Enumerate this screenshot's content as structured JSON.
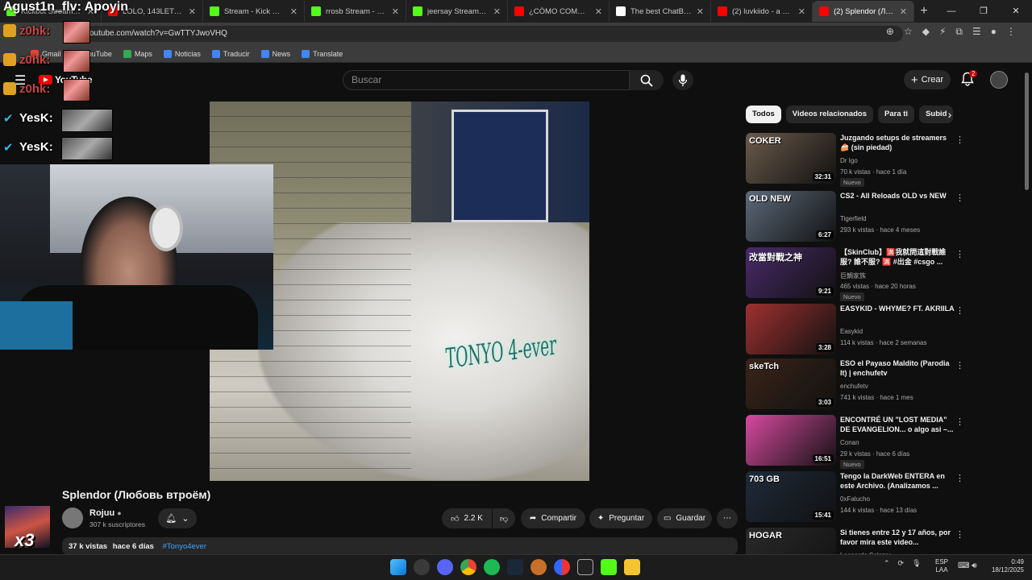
{
  "browser": {
    "tabs": [
      {
        "title": "Kickbot Stream Widget",
        "color": "#53fc18"
      },
      {
        "title": "LOLO, 143LETI - LUN",
        "color": "#ff0000"
      },
      {
        "title": "Stream - Kick Dashbo",
        "color": "#53fc18"
      },
      {
        "title": "rrosb Stream - Watch",
        "color": "#53fc18"
      },
      {
        "title": "jeersay Stream - Wat",
        "color": "#53fc18"
      },
      {
        "title": "¿CÓMO COMPRAR",
        "color": "#ff0000"
      },
      {
        "title": "The best ChatBot and",
        "color": "#ffffff"
      },
      {
        "title": "(2) luvkiido - a escon",
        "color": "#ff0000"
      },
      {
        "title": "(2) Splendor (Любовь",
        "color": "#ff0000"
      }
    ],
    "new_tab": "+",
    "url": "youtube.com/watch?v=GwTTYJwoVHQ",
    "bookmarks": [
      {
        "label": "Gmail",
        "color": "#ea4335"
      },
      {
        "label": "YouTube",
        "color": "#ff0000"
      },
      {
        "label": "Maps",
        "color": "#34a853"
      },
      {
        "label": "Noticias",
        "color": "#4285f4"
      },
      {
        "label": "Traducir",
        "color": "#4285f4"
      },
      {
        "label": "News",
        "color": "#4285f4"
      },
      {
        "label": "Translate",
        "color": "#4285f4"
      }
    ]
  },
  "youtube": {
    "logo": "YouTube",
    "search_placeholder": "Buscar",
    "create_label": "Crear",
    "notif_count": "2",
    "video_title": "Splendor (Любовь втроём)",
    "channel_name": "Rojuu",
    "channel_subs": "307 k suscriptores",
    "likes": "2.2 K",
    "share_label": "Compartir",
    "ask_label": "Preguntar",
    "save_label": "Guardar",
    "views": "37 k vistas",
    "uploaded": "hace 6 días",
    "hashtag": "#Tonyo4ever",
    "video_overlay_text": "TONYO 4-ever",
    "chips": [
      "Todos",
      "Videos relacionados",
      "Para ti",
      "Subid"
    ],
    "recommendations": [
      {
        "title": "Juzgando setups de streamers 🍰 (sin piedad)",
        "channel": "Dr Igo",
        "meta": "70 k vistas · hace 1 día",
        "duration": "32:31",
        "badge": "Nuevo",
        "thumb": "#6b5a4a",
        "thumb_text": "COKER"
      },
      {
        "title": "CS2 - All Reloads OLD vs NEW",
        "channel": "Tigerfield",
        "meta": "293 k vistas · hace 4 meses",
        "duration": "6:27",
        "badge": "",
        "thumb": "#5c6a7a",
        "thumb_text": "OLD   NEW"
      },
      {
        "title": "【SkinClub】🈵我就問這對戰誰服? 誰不服? 🈵 #出金 #csgo ...",
        "channel": "巨鯛家族",
        "meta": "465 vistas · hace 20 horas",
        "duration": "9:21",
        "badge": "Nuevo",
        "thumb": "#4a2a6a",
        "thumb_text": "改當對戰之神"
      },
      {
        "title": "EASYKID - WHYME? FT. AKRIILA",
        "channel": "Easykid",
        "meta": "114 k vistas · hace 2 semanas",
        "duration": "3:28",
        "badge": "",
        "thumb": "#a03030",
        "thumb_text": ""
      },
      {
        "title": "ESO el Payaso Maldito (Parodia It) | enchufetv",
        "channel": "enchufetv",
        "meta": "741 k vistas · hace 1 mes",
        "duration": "3:03",
        "badge": "",
        "thumb": "#3a2418",
        "thumb_text": "skeTch"
      },
      {
        "title": "ENCONTRÉ UN \"LOST MEDIA\" DE EVANGELION... o algo asi –...",
        "channel": "Conan",
        "meta": "29 k vistas · hace 6 días",
        "duration": "16:51",
        "badge": "Nuevo",
        "thumb": "#d84aa0",
        "thumb_text": ""
      },
      {
        "title": "Tengo la DarkWeb ENTERA en este Archivo. (Analizamos ...",
        "channel": "0xFalucho",
        "meta": "144 k vistas · hace 13 días",
        "duration": "15:41",
        "badge": "",
        "thumb": "#1e2a3a",
        "thumb_text": "703 GB"
      },
      {
        "title": "Si tienes entre 12 y 17 años, por favor mira este video...",
        "channel": "Leonardo Salazar",
        "meta": "",
        "duration": "",
        "badge": "",
        "thumb": "#2a2a2a",
        "thumb_text": "HOGAR"
      }
    ]
  },
  "stream_overlay": {
    "streamer_name": "Agust1n_flv: Apoyin",
    "chat_lines": [
      "z0hk:",
      "z0hk:",
      "z0hk:",
      "YesK:",
      "YesK:"
    ],
    "multiplier": "x3"
  },
  "taskbar": {
    "lang_top": "ESP",
    "lang_bottom": "LAA",
    "time": "0:49",
    "date": "18/12/2025"
  }
}
